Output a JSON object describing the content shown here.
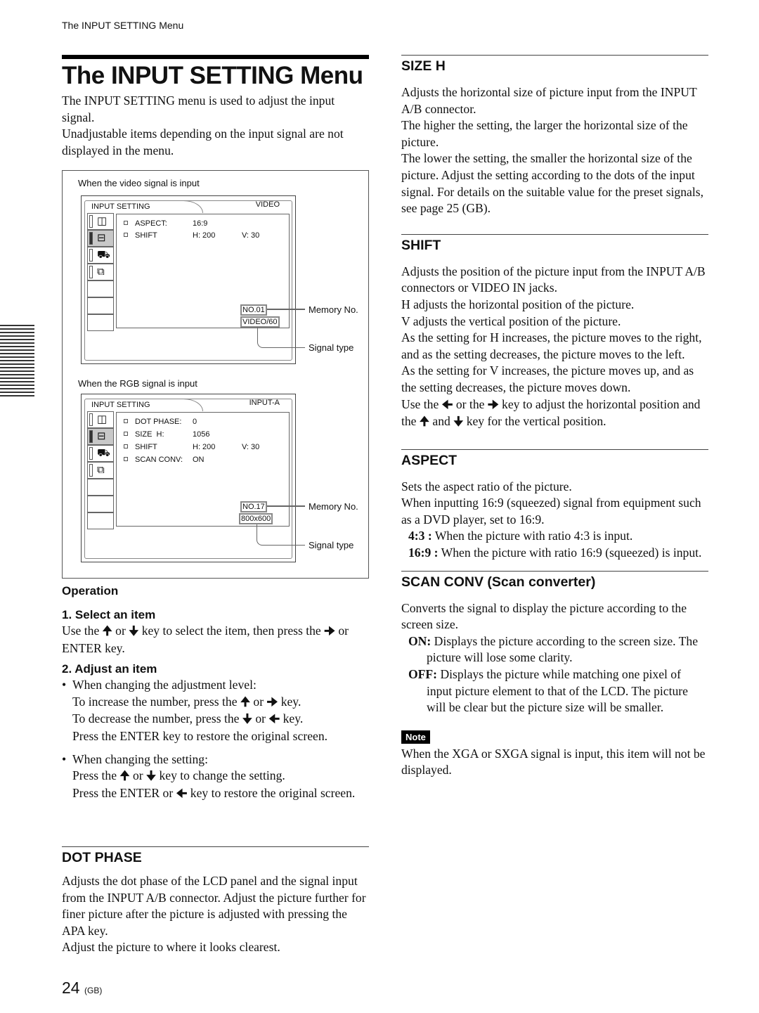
{
  "running_header": "The INPUT SETTING Menu",
  "page_title": "The INPUT SETTING Menu",
  "intro": [
    "The INPUT SETTING menu is used to adjust the input signal.",
    "Unadjustable items depending on the input signal are not displayed in the menu."
  ],
  "figures": [
    {
      "caption": "When the video signal is input",
      "osd_title": "INPUT SETTING",
      "signal_label": "VIDEO",
      "selected_icon_index": 1,
      "rows": [
        {
          "label": "ASPECT:",
          "value1": "16:9",
          "value2": ""
        },
        {
          "label": "SHIFT",
          "value1": "H: 200",
          "value2": "V: 30"
        }
      ],
      "memory_badge": "NO.01",
      "signal_badge": "VIDEO/60",
      "memory_callout": "Memory No.",
      "signal_callout": "Signal type"
    },
    {
      "caption": "When the RGB signal is input",
      "osd_title": "INPUT SETTING",
      "signal_label": "INPUT-A",
      "selected_icon_index": 1,
      "rows": [
        {
          "label": "DOT PHASE:",
          "value1": "0",
          "value2": ""
        },
        {
          "label": "SIZE  H:",
          "value1": "1056",
          "value2": ""
        },
        {
          "label": "SHIFT",
          "value1": "H: 200",
          "value2": "V: 30"
        },
        {
          "label": "SCAN CONV:",
          "value1": "ON",
          "value2": ""
        }
      ],
      "memory_badge": "NO.17",
      "signal_badge": "800x600",
      "memory_callout": "Memory No.",
      "signal_callout": "Signal type"
    }
  ],
  "osd_icons": [
    "picture-icon",
    "input-setting-icon",
    "setup-icon",
    "installation-icon"
  ],
  "operation": {
    "heading": "Operation",
    "step1": {
      "heading": "1. Select an item",
      "text_a": "Use the",
      "text_b": "or",
      "text_c": "key to select the item, then press the",
      "text_d": "or ENTER key."
    },
    "step2": {
      "heading": "2. Adjust an item",
      "bullet1": {
        "lead": "When changing the adjustment level:",
        "inc_a": "To increase the number, press the",
        "inc_b": "or",
        "inc_c": "key.",
        "dec_a": "To decrease the number, press the",
        "dec_b": "or",
        "dec_c": "key.",
        "restore": "Press the ENTER key to restore the original screen."
      },
      "bullet2": {
        "lead": "When changing the setting:",
        "press_a": "Press the",
        "press_b": "or",
        "press_c": "key to change the setting.",
        "restore_a": "Press the ENTER or",
        "restore_b": "key to restore the original screen."
      }
    }
  },
  "arrows": {
    "up": "🠉",
    "down": "🠋",
    "left": "🠈",
    "right": "🠊"
  },
  "sections": {
    "dot_phase": {
      "heading": "DOT PHASE",
      "text": "Adjusts the dot phase of the LCD panel and the signal input from the INPUT A/B connector. Adjust the picture further for finer picture after the picture is adjusted with pressing the APA key.",
      "text2": "Adjust the picture to where it looks clearest."
    },
    "size_h": {
      "heading": "SIZE H",
      "paras": [
        "Adjusts the horizontal size of picture input from the INPUT A/B connector.",
        "The higher the setting, the larger the horizontal size of the picture.",
        "The lower the setting, the smaller the horizontal size of the picture. Adjust the setting according to the dots of the input signal. For details on the suitable value for the preset signals, see page 25 (GB)."
      ]
    },
    "shift": {
      "heading": "SHIFT",
      "paras": [
        "Adjusts the position of the picture input from the INPUT A/B connectors or VIDEO IN jacks.",
        "H adjusts the horizontal position of the picture.",
        "V adjusts the vertical position of the picture.",
        "As the setting for H increases, the picture moves to the right, and as the setting decreases, the picture moves to the left.",
        "As the setting for V increases, the picture moves up, and as the setting decreases, the picture moves down."
      ],
      "keys_a": "Use the",
      "keys_b": "or the",
      "keys_c": "key to adjust the horizontal position and the",
      "keys_d": "and",
      "keys_e": "key for the vertical position."
    },
    "aspect": {
      "heading": "ASPECT",
      "paras": [
        "Sets the aspect ratio of the picture.",
        "When inputting 16:9 (squeezed) signal from equipment such as a DVD player, set to 16:9."
      ],
      "options": [
        {
          "term": "4:3 :",
          "desc": "When the picture with ratio 4:3 is input."
        },
        {
          "term": "16:9 :",
          "desc": "When the picture with ratio 16:9 (squeezed) is input."
        }
      ]
    },
    "scan_conv": {
      "heading": "SCAN CONV (Scan converter)",
      "text": "Converts the signal to display the picture according to the screen size.",
      "options": [
        {
          "term": "ON:",
          "desc": "Displays the picture according to the screen size. The picture will lose some clarity."
        },
        {
          "term": "OFF:",
          "desc": "Displays the picture while matching one pixel of input picture element to that of the LCD. The picture will be clear but the picture size will be smaller."
        }
      ],
      "note_label": "Note",
      "note_text": "When the XGA or SXGA signal is input, this item will not be displayed."
    }
  },
  "page_number": "24",
  "page_suffix": "(GB)"
}
